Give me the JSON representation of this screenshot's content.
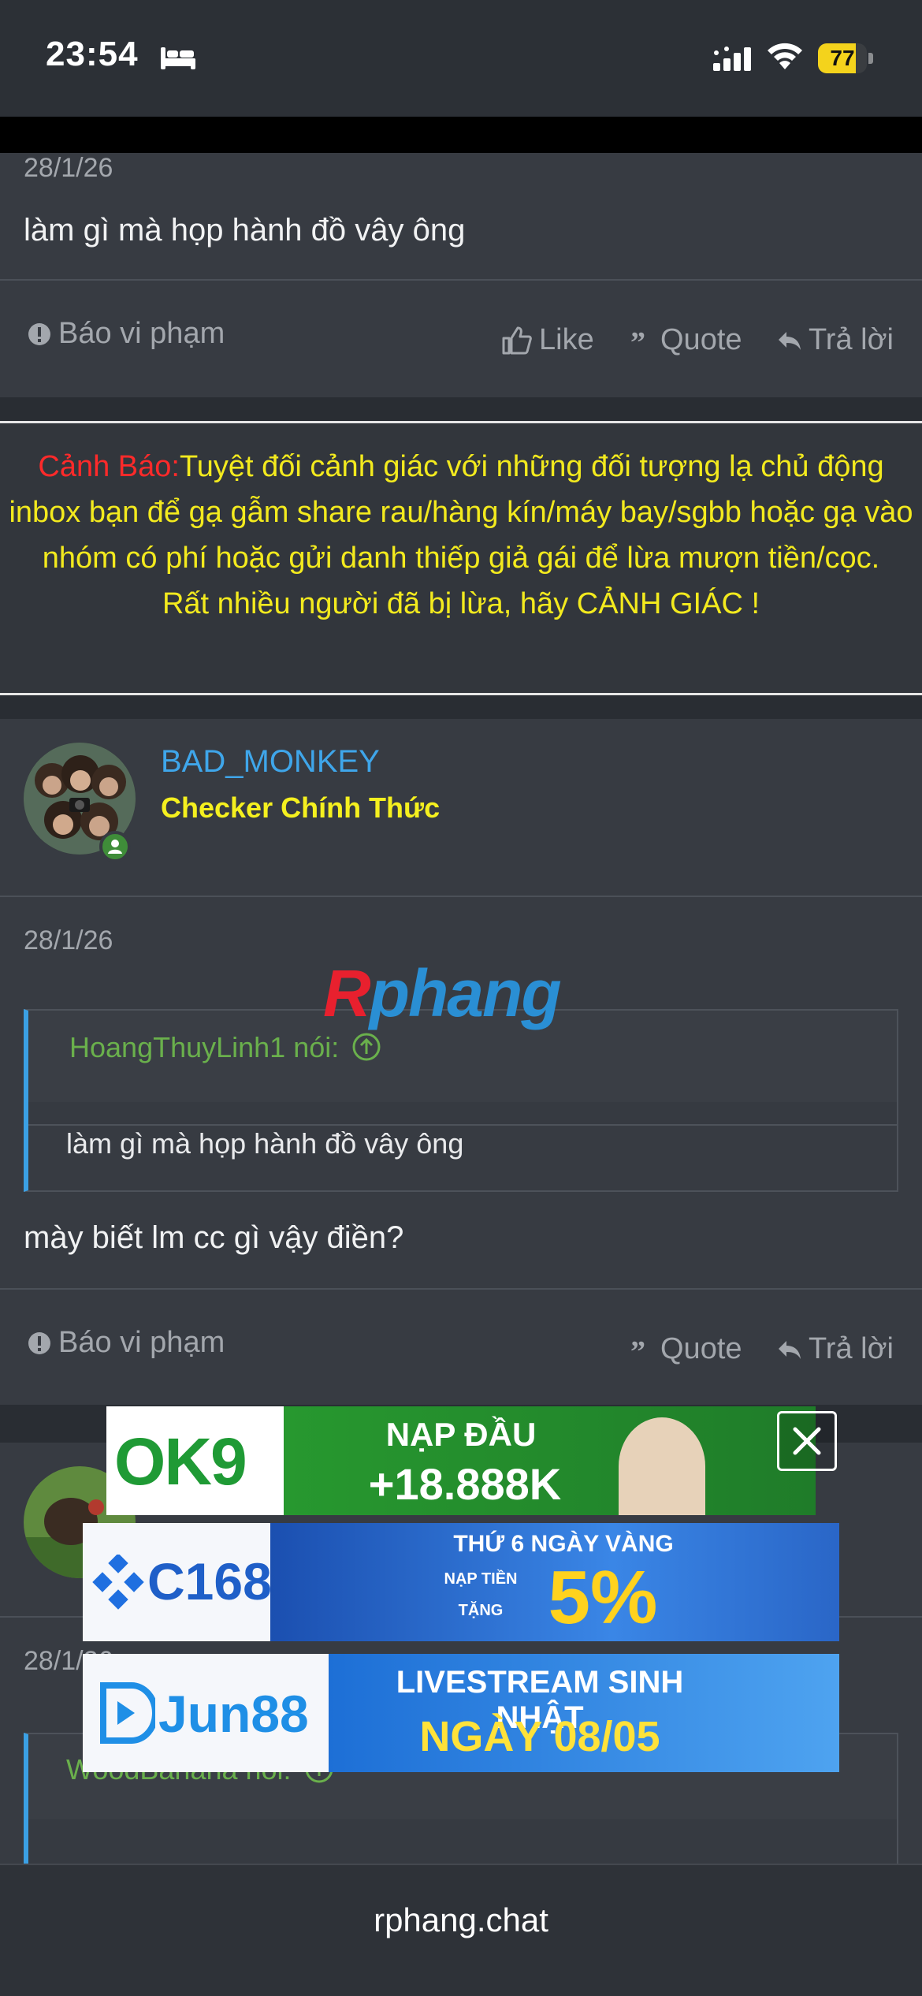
{
  "status_bar": {
    "time": "23:54",
    "battery": "77",
    "battery_level": 0.77,
    "icons": [
      "bed-icon",
      "signal-icon",
      "wifi-icon",
      "battery-icon"
    ]
  },
  "post1": {
    "date": "28/1/26",
    "text": "làm gì mà họp hành đồ vây ông",
    "report_label": "Báo vi phạm",
    "like_label": "Like",
    "quote_label": "Quote",
    "reply_label": "Trả lời"
  },
  "warning": {
    "label": "Cảnh Báo:",
    "text": "Tuyệt đối cảnh giác với những đối tượng lạ chủ động inbox bạn để gạ gẫm share rau/hàng kín/máy bay/sgbb hoặc gạ vào nhóm có phí hoặc gửi danh thiếp giả gái để lừa mượn tiền/cọc.",
    "line2": "Rất nhiều người đã bị lừa, hãy CẢNH GIÁC !"
  },
  "post2": {
    "username": "BAD_MONKEY",
    "user_title": "Checker Chính Thức",
    "date": "28/1/26",
    "quote_author": "HoangThuyLinh1 nói:",
    "quote_text": "làm gì mà họp hành đồ vây ông",
    "text": "mày biết lm cc gì vậy điền?",
    "report_label": "Báo vi phạm",
    "quote_label": "Quote",
    "reply_label": "Trả lời"
  },
  "post3": {
    "date": "28/1/26",
    "quote_author": "WoodBanana nói:"
  },
  "watermark": {
    "r": "R",
    "rest": "phang"
  },
  "ads": {
    "ad1": {
      "brand": "OK9",
      "line1": "NẠP ĐẦU",
      "line2": "+18.888K"
    },
    "ad2": {
      "brand": "C168",
      "line1": "THỨ 6 NGÀY VÀNG",
      "small": "NẠP TIỀN",
      "small2": "TẶNG",
      "big": "5%"
    },
    "ad3": {
      "brand": "Jun88",
      "line1": "LIVESTREAM SINH NHẬT",
      "line2": "NGÀY 08/05"
    }
  },
  "browser": {
    "url": "rphang.chat"
  },
  "colors": {
    "background": "#292d33",
    "panel": "#373b42",
    "username": "#3fa6ea",
    "user_title": "#f5f01f",
    "warning_text": "#f3ea1e",
    "warning_label": "#ff2a2a",
    "quote_author": "#6ab04c",
    "quote_border": "#3ba0e4"
  }
}
